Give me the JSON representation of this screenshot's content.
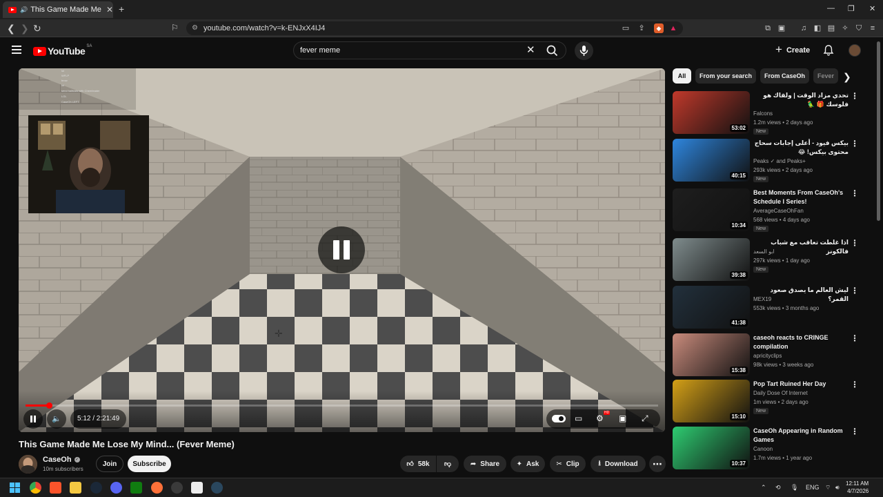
{
  "browser": {
    "tab_title": "This Game Made Me Lose My Mind... (Fever Meme)",
    "url": "youtube.com/watch?v=k-ENJxX4IJ4",
    "new_tab": "+",
    "minimize": "—",
    "restore": "❐",
    "close": "✕"
  },
  "youtube": {
    "logo_text": "YouTube",
    "country_code": "SA",
    "search_query": "fever meme",
    "create_label": "Create"
  },
  "player": {
    "time": "5:12 / 2:21:49",
    "progress_fraction": 0.0367,
    "chat_lines": [
      "lol",
      "WFLP",
      "brow",
      "lol",
      "send halitosis with Cheerleader",
      "LOL",
      "CaseOh  LEFT"
    ]
  },
  "video": {
    "title": "This Game Made Me Lose My Mind... (Fever Meme)",
    "channel": "CaseOh",
    "subscribers": "10m subscribers",
    "join_label": "Join",
    "subscribe_label": "Subscribe",
    "likes": "58k",
    "share_label": "Share",
    "ask_label": "Ask",
    "clip_label": "Clip",
    "download_label": "Download"
  },
  "chips": [
    "All",
    "From your search",
    "From CaseOh",
    "Fever"
  ],
  "related": [
    {
      "title": "تحدي مزاد الوقت | ولقاك هو فلوسك 🎁 🦜",
      "channel": "Falcons",
      "meta": "1.2m views • 2 days ago",
      "badge": "New",
      "duration": "53:02",
      "color": "#c0392b"
    },
    {
      "title": "بيكس فيود - أعلى إجابات سحاج محتوى بيكس! 😂",
      "channel": "Peaks ✓ and Peaks+",
      "meta": "293k views • 2 days ago",
      "badge": "New",
      "duration": "40:15",
      "color": "#2e86de"
    },
    {
      "title": "Best Moments From CaseOh's Schedule I Series!",
      "channel": "AverageCaseOhFan",
      "meta": "568 views • 4 days ago",
      "badge": "New",
      "duration": "10:34",
      "color": "#1e1e1e"
    },
    {
      "title": "اذا غلطت تعاقب مع شباب فالكونز",
      "channel": "ابو السعد",
      "meta": "297k views • 1 day ago",
      "badge": "New",
      "duration": "39:38",
      "color": "#7f8c8d"
    },
    {
      "title": "ليش العالم ما يصدق صعود القمر؟",
      "channel": "MEX19",
      "meta": "553k views • 3 months ago",
      "badge": "",
      "duration": "41:38",
      "color": "#22303c"
    },
    {
      "title": "caseoh reacts to CRINGE compilation",
      "channel": "apricityclips",
      "meta": "98k views • 3 weeks ago",
      "badge": "",
      "duration": "15:38",
      "color": "#c98b7c"
    },
    {
      "title": "Pop Tart Ruined Her Day",
      "channel": "Daily Dose Of Internet",
      "meta": "1m views • 2 days ago",
      "badge": "New",
      "duration": "15:10",
      "color": "#d4a017"
    },
    {
      "title": "CaseOh Appearing in Random Games",
      "channel": "Canoon",
      "meta": "1.7m views • 1 year ago",
      "badge": "",
      "duration": "10:37",
      "color": "#2ecc71"
    }
  ],
  "taskbar": {
    "lang": "ENG",
    "time": "12:11 AM",
    "date": "4/7/2026"
  }
}
